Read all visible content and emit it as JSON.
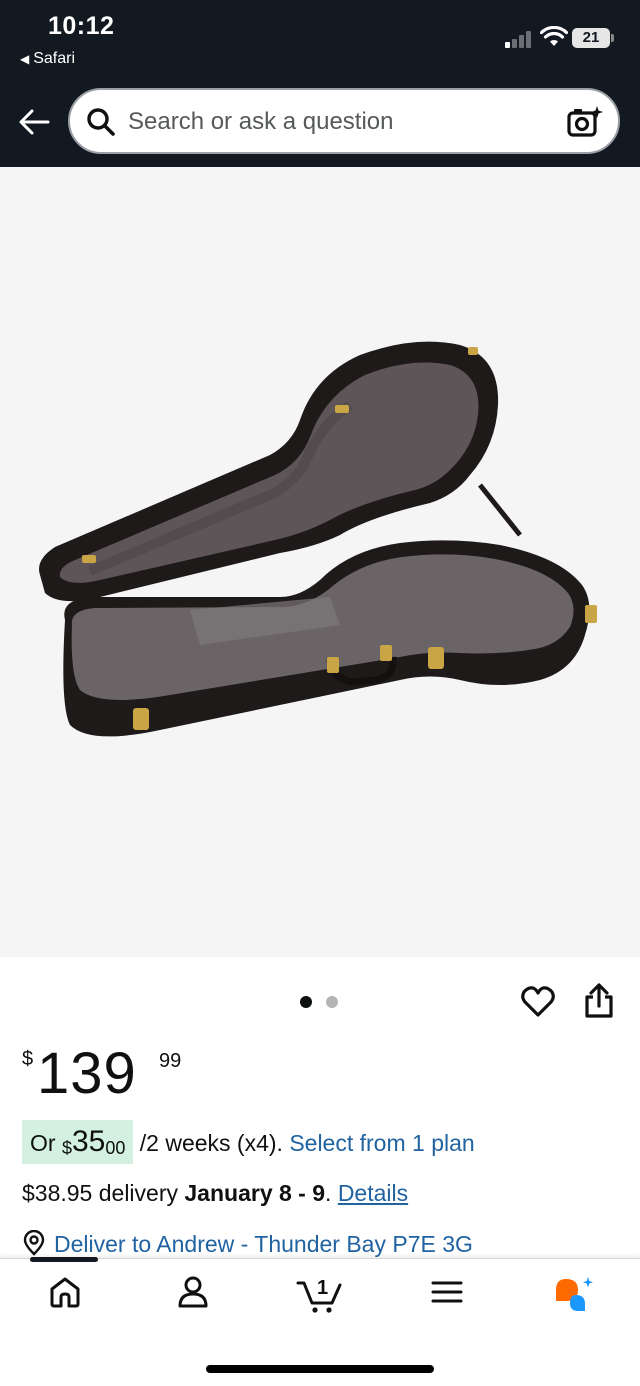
{
  "status_bar": {
    "time": "10:12",
    "back_app": "Safari",
    "battery": "21"
  },
  "search": {
    "placeholder": "Search or ask a question"
  },
  "carousel": {
    "total_images": 2,
    "active_index": 0
  },
  "product": {
    "price_currency": "$",
    "price_whole": "139",
    "price_fraction": "99",
    "plan": {
      "prefix": "Or ",
      "currency": "$",
      "amount_whole": "35",
      "amount_fraction": "00",
      "term": "/2 weeks (x4).",
      "link": "Select from 1 plan"
    },
    "delivery": {
      "cost_text": "$38.95 delivery",
      "dates": "January 8 - 9",
      "period": ".",
      "details_link": "Details"
    },
    "deliver_to": "Deliver to Andrew - Thunder Bay P7E 3G"
  },
  "bottom_nav": {
    "items": [
      {
        "name": "home",
        "icon": "home-icon"
      },
      {
        "name": "account",
        "icon": "person-icon"
      },
      {
        "name": "cart",
        "icon": "cart-icon",
        "count": "1"
      },
      {
        "name": "menu",
        "icon": "menu-icon"
      },
      {
        "name": "assistant",
        "icon": "rufus-icon"
      }
    ],
    "active": "home"
  },
  "colors": {
    "header_bg": "#131921",
    "link": "#2162a1",
    "plan_highlight": "#d3f0e1",
    "assistant_orange": "#ff6a00",
    "assistant_blue": "#1a98ff"
  }
}
